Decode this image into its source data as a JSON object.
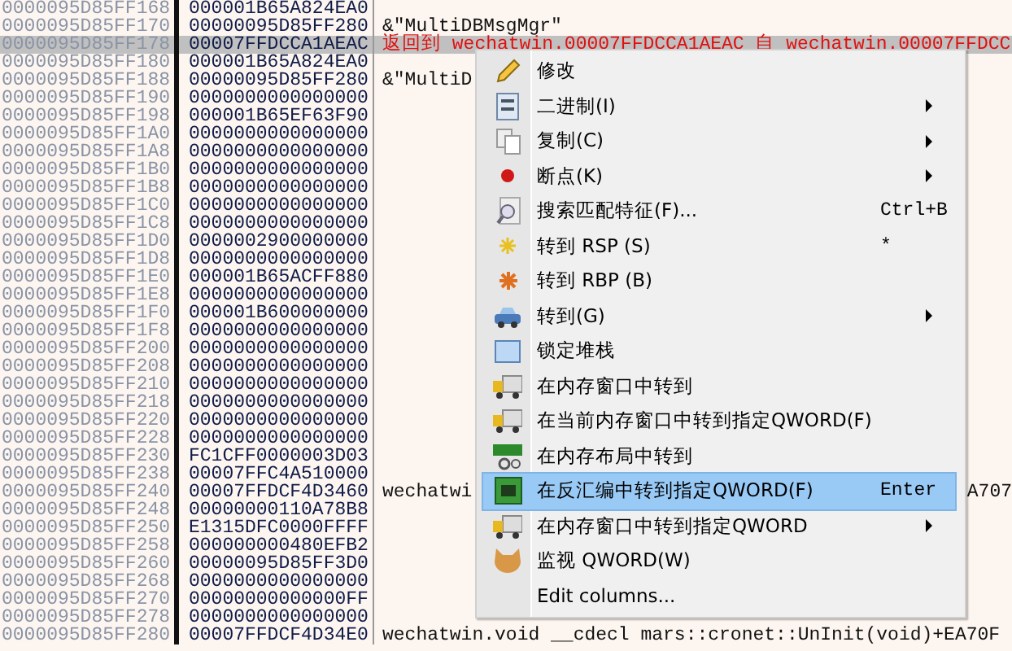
{
  "stack": {
    "rows": [
      {
        "address": "0000095D85FF168",
        "value": "000001B65A824EA0",
        "selected": false
      },
      {
        "address": "0000095D85FF170",
        "value": "00000095D85FF280",
        "selected": false,
        "comment": "&\"MultiDBMsgMgr\"",
        "is_return": false
      },
      {
        "address": "0000095D85FF178",
        "value": "00007FFDCCA1AEAC",
        "selected": true,
        "comment": "返回到 wechatwin.00007FFDCCA1AEAC 自 wechatwin.00007FFDCC",
        "is_return": true
      },
      {
        "address": "0000095D85FF180",
        "value": "000001B65A824EA0",
        "selected": false
      },
      {
        "address": "0000095D85FF188",
        "value": "00000095D85FF280",
        "selected": false,
        "comment": "&\"MultiD",
        "is_return": false
      },
      {
        "address": "0000095D85FF190",
        "value": "0000000000000000",
        "selected": false
      },
      {
        "address": "0000095D85FF198",
        "value": "000001B65EF63F90",
        "selected": false
      },
      {
        "address": "0000095D85FF1A0",
        "value": "0000000000000000",
        "selected": false
      },
      {
        "address": "0000095D85FF1A8",
        "value": "0000000000000000",
        "selected": false
      },
      {
        "address": "0000095D85FF1B0",
        "value": "0000000000000000",
        "selected": false
      },
      {
        "address": "0000095D85FF1B8",
        "value": "0000000000000000",
        "selected": false
      },
      {
        "address": "0000095D85FF1C0",
        "value": "0000000000000000",
        "selected": false
      },
      {
        "address": "0000095D85FF1C8",
        "value": "0000000000000000",
        "selected": false
      },
      {
        "address": "0000095D85FF1D0",
        "value": "0000002900000000",
        "selected": false
      },
      {
        "address": "0000095D85FF1D8",
        "value": "0000000000000000",
        "selected": false
      },
      {
        "address": "0000095D85FF1E0",
        "value": "000001B65ACFF880",
        "selected": false
      },
      {
        "address": "0000095D85FF1E8",
        "value": "0000000000000000",
        "selected": false
      },
      {
        "address": "0000095D85FF1F0",
        "value": "000001B600000000",
        "selected": false
      },
      {
        "address": "0000095D85FF1F8",
        "value": "0000000000000000",
        "selected": false
      },
      {
        "address": "0000095D85FF200",
        "value": "0000000000000000",
        "selected": false
      },
      {
        "address": "0000095D85FF208",
        "value": "0000000000000000",
        "selected": false
      },
      {
        "address": "0000095D85FF210",
        "value": "0000000000000000",
        "selected": false
      },
      {
        "address": "0000095D85FF218",
        "value": "0000000000000000",
        "selected": false
      },
      {
        "address": "0000095D85FF220",
        "value": "0000000000000000",
        "selected": false
      },
      {
        "address": "0000095D85FF228",
        "value": "0000000000000000",
        "selected": false
      },
      {
        "address": "0000095D85FF230",
        "value": "FC1CFF0000003D03",
        "selected": false
      },
      {
        "address": "0000095D85FF238",
        "value": "00007FFC4A510000",
        "selected": false
      },
      {
        "address": "0000095D85FF240",
        "value": "00007FFDCF4D3460",
        "selected": false,
        "comment": "wechatwi",
        "is_return": false,
        "comment_tail": "A707"
      },
      {
        "address": "0000095D85FF248",
        "value": "00000000110A78B8",
        "selected": false
      },
      {
        "address": "0000095D85FF250",
        "value": "E1315DFC0000FFFF",
        "selected": false
      },
      {
        "address": "0000095D85FF258",
        "value": "000000000480EFB2",
        "selected": false
      },
      {
        "address": "0000095D85FF260",
        "value": "00000095D85FF3D0",
        "selected": false
      },
      {
        "address": "0000095D85FF268",
        "value": "0000000000000000",
        "selected": false
      },
      {
        "address": "0000095D85FF270",
        "value": "00000000000000FF",
        "selected": false
      },
      {
        "address": "0000095D85FF278",
        "value": "0000000000000000",
        "selected": false
      },
      {
        "address": "0000095D85FF280",
        "value": "00007FFDCF4D34E0",
        "selected": false,
        "comment": "wechatwin.void __cdecl mars::cronet::UnInit(void)+EA70F",
        "is_return": false
      }
    ]
  },
  "context_menu": {
    "items": [
      {
        "label": "修改",
        "selected": false,
        "submenu": false
      },
      {
        "label": "二进制(I)",
        "selected": false,
        "submenu": true
      },
      {
        "label": "复制(C)",
        "selected": false,
        "submenu": true
      },
      {
        "label": "断点(K)",
        "selected": false,
        "submenu": true
      },
      {
        "label": "搜索匹配特征(F)...",
        "selected": false,
        "submenu": false,
        "shortcut": "Ctrl+B"
      },
      {
        "label": "转到 RSP (S)",
        "selected": false,
        "submenu": false,
        "shortcut": "*"
      },
      {
        "label": "转到 RBP (B)",
        "selected": false,
        "submenu": false
      },
      {
        "label": "转到(G)",
        "selected": false,
        "submenu": true
      },
      {
        "label": "锁定堆栈",
        "selected": false,
        "submenu": false
      },
      {
        "label": "在内存窗口中转到",
        "selected": false,
        "submenu": false
      },
      {
        "label": "在当前内存窗口中转到指定QWORD(F)",
        "selected": false,
        "submenu": false
      },
      {
        "label": "在内存布局中转到",
        "selected": false,
        "submenu": false
      },
      {
        "label": "在反汇编中转到指定QWORD(F)",
        "selected": true,
        "submenu": false,
        "shortcut": "Enter"
      },
      {
        "label": "在内存窗口中转到指定QWORD",
        "selected": false,
        "submenu": true
      },
      {
        "label": "监视 QWORD(W)",
        "selected": false,
        "submenu": false
      },
      {
        "label": "Edit columns...",
        "selected": false,
        "submenu": false
      }
    ]
  }
}
